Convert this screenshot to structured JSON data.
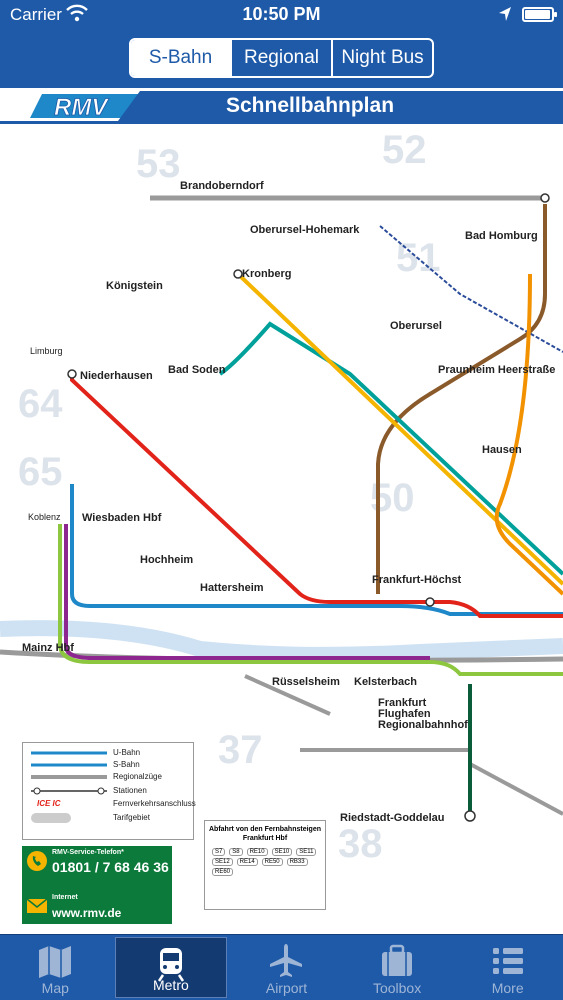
{
  "status": {
    "carrier": "Carrier",
    "time": "10:50 PM",
    "battery_level": 0.95
  },
  "segments": {
    "items": [
      "S-Bahn",
      "Regional",
      "Night Bus"
    ],
    "active_index": 0
  },
  "banner": {
    "logo": "RMV",
    "title": "Schnellbahnplan"
  },
  "map": {
    "zones": [
      "53",
      "52",
      "51",
      "64",
      "65",
      "50",
      "37",
      "38"
    ],
    "stations": [
      "Brandoberndorf",
      "Oberursel-Hohemark",
      "Bad Homburg",
      "Königstein",
      "Kronberg",
      "Oberursel",
      "Bad Soden",
      "Niederhausen",
      "Praunheim Heerstraße",
      "Hausen",
      "Wiesbaden Hbf",
      "Hochheim",
      "Hattersheim",
      "Frankfurt-Höchst",
      "Mainz Hbf",
      "Rüsselsheim",
      "Kelsterbach",
      "Frankfurt Flughafen Regionalbahnhof",
      "Riedstadt-Goddelau",
      "Koblenz",
      "Limburg"
    ],
    "legend": {
      "ubahn": "U-Bahn",
      "sbahn": "S-Bahn",
      "regional": "Regionalzüge",
      "stations": "Stationen",
      "fern_icon": "ICE IC",
      "fern": "Fernverkehrsanschluss",
      "tarif": "Tarifgebiet"
    },
    "promo": {
      "service": "RMV-Service-Telefon*",
      "phone": "01801 / 7 68 46 36",
      "internet": "Internet",
      "url": "www.rmv.de"
    },
    "departure": {
      "header": "Abfahrt von den Fernbahnsteigen Frankfurt Hbf",
      "codes": [
        "S7",
        "S8",
        "RE10",
        "SE10",
        "SE11",
        "SE12",
        "RE14",
        "RE50",
        "RB33",
        "RE60"
      ]
    }
  },
  "tabs": [
    {
      "label": "Map",
      "icon": "map-icon"
    },
    {
      "label": "Metro",
      "icon": "train-icon"
    },
    {
      "label": "Airport",
      "icon": "airplane-icon"
    },
    {
      "label": "Toolbox",
      "icon": "toolbox-icon"
    },
    {
      "label": "More",
      "icon": "list-icon"
    }
  ],
  "tab_active_index": 1,
  "colors": {
    "brand": "#1e5aa8",
    "s1": "#1e88c8",
    "s2": "#e2231a",
    "s3": "#00a19a",
    "s4": "#f4b400",
    "s5": "#8b5a2b",
    "s6": "#f39200",
    "s7": "#0b5c3b",
    "s8": "#8dc63f",
    "s9": "#8e2690",
    "regional": "#9a9a9a"
  }
}
